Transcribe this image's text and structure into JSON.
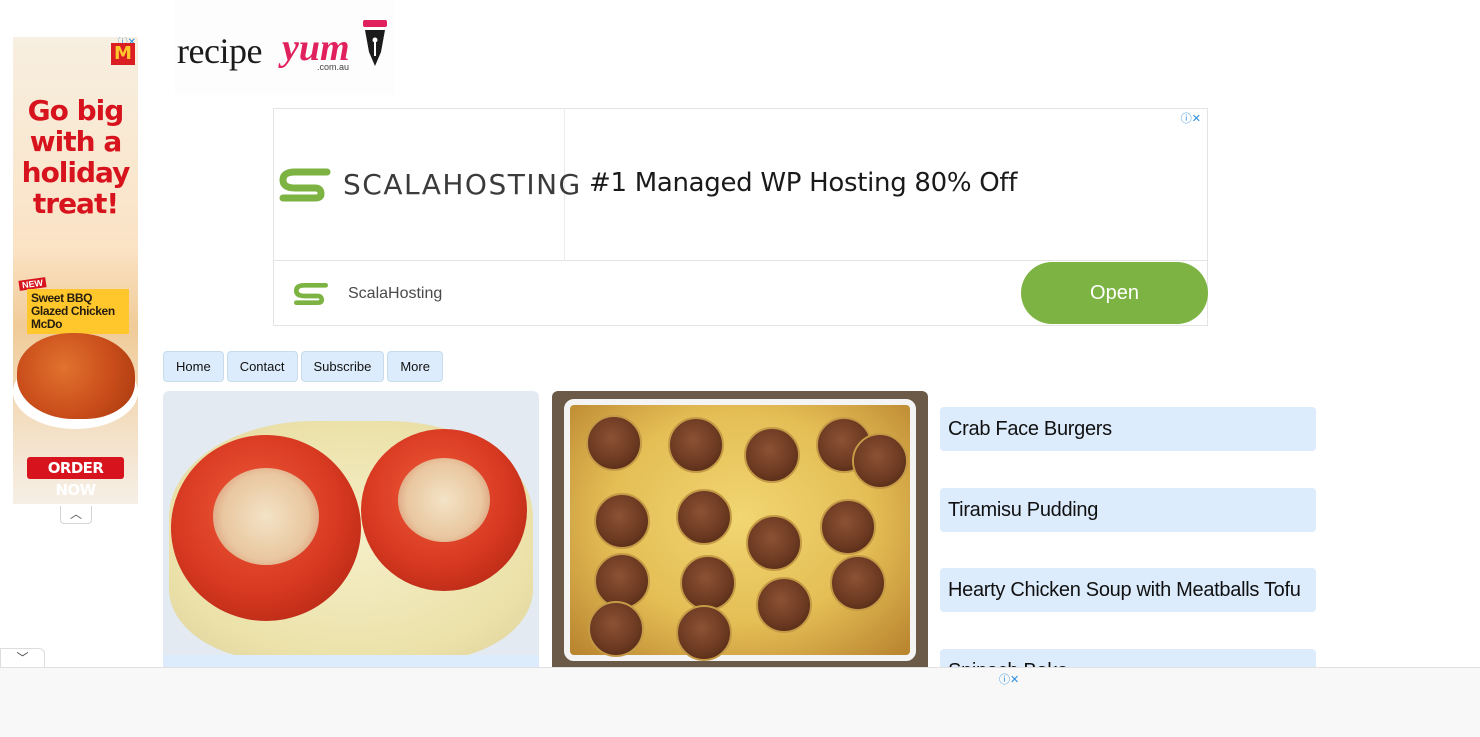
{
  "side_ad": {
    "ad_marks": "ⓘ✕",
    "brand_icon": "mcdonalds-logo-icon",
    "brand_mark": "M",
    "headline": "Go big with a holiday treat!",
    "new_tag": "NEW",
    "product": "Sweet BBQ Glazed Chicken McDo",
    "cta": "ORDER NOW",
    "collapse_icon": "︿"
  },
  "logo": {
    "recipe": "recipe",
    "yum": "yum",
    "domain": ".com.au"
  },
  "banner_ad": {
    "ad_marks": "ⓘ✕",
    "brand_name": "SCALAHOSTING",
    "headline": "#1 Managed WP Hosting 80% Off",
    "advertiser": "ScalaHosting",
    "cta": "Open",
    "accent_color": "#7cb342"
  },
  "nav": {
    "items": [
      {
        "label": "Home"
      },
      {
        "label": "Contact"
      },
      {
        "label": "Subscribe"
      },
      {
        "label": "More"
      }
    ]
  },
  "sidebar": {
    "links": [
      {
        "label": "Crab Face Burgers"
      },
      {
        "label": "Tiramisu Pudding"
      },
      {
        "label": "Hearty Chicken Soup with Meatballs Tofu"
      },
      {
        "label": "Spinach Bake"
      }
    ]
  },
  "anchor_ad": {
    "toggle_icon": "﹀",
    "ad_marks": "ⓘ✕"
  }
}
